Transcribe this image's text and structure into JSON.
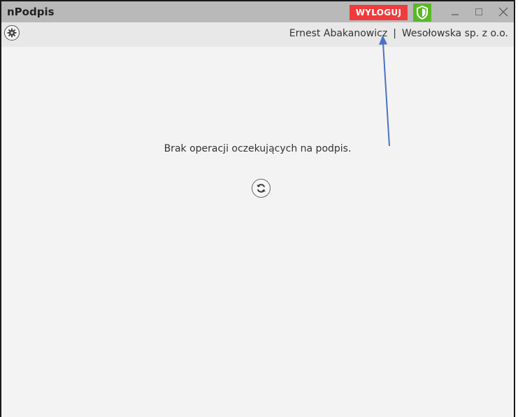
{
  "window": {
    "title": "nPodpis",
    "logout_label": "WYLOGUJ"
  },
  "toolbar": {
    "user_name": "Ernest Abakanowicz",
    "separator": "|",
    "company": "Wesołowska sp. z o.o."
  },
  "main": {
    "empty_message": "Brak operacji oczekujących na podpis."
  },
  "icons": {
    "shield": "shield-icon",
    "settings": "gear-icon",
    "refresh": "refresh-icon"
  },
  "colors": {
    "logout_bg": "#ef3b3b",
    "shield_bg": "#5ab826",
    "annotation_arrow": "#4a72c4"
  }
}
